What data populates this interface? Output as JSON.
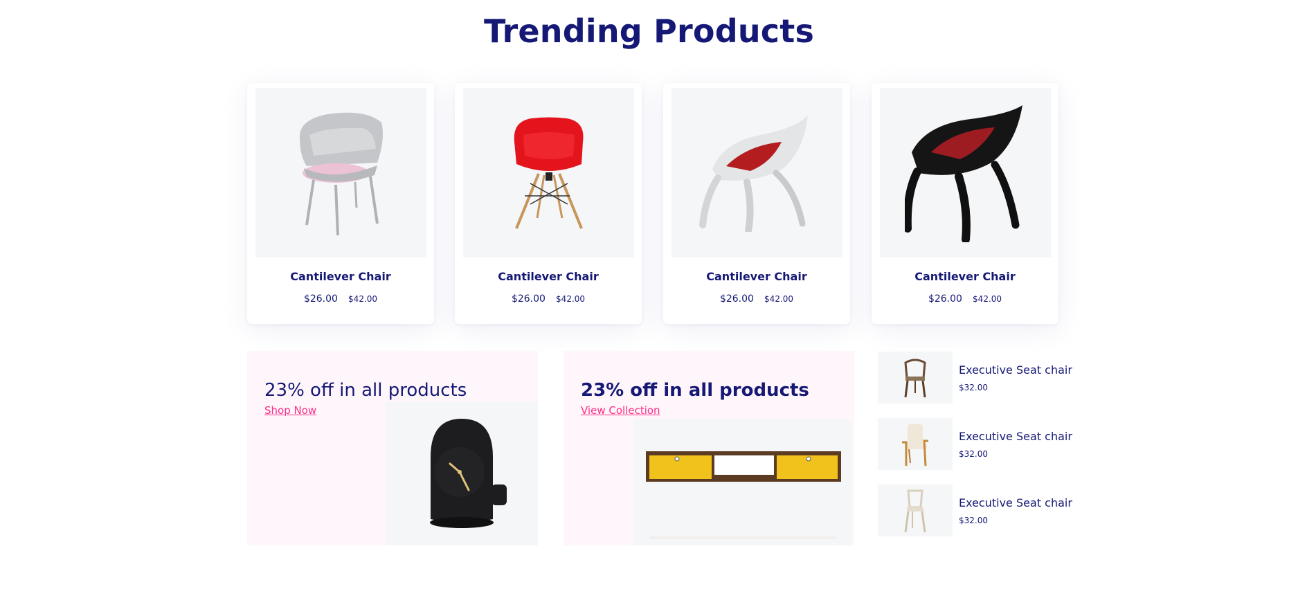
{
  "section": {
    "title": "Trending Products"
  },
  "products": [
    {
      "name": "Cantilever Chair",
      "price": "$26.00",
      "old_price": "$42.00",
      "image": "grey-pink-chair"
    },
    {
      "name": "Cantilever Chair",
      "price": "$26.00",
      "old_price": "$42.00",
      "image": "red-eames-chair"
    },
    {
      "name": "Cantilever Chair",
      "price": "$26.00",
      "old_price": "$42.00",
      "image": "white-red-pod-chair"
    },
    {
      "name": "Cantilever Chair",
      "price": "$26.00",
      "old_price": "$42.00",
      "image": "black-red-pod-chair"
    }
  ],
  "promos": [
    {
      "title": "23% off in all products",
      "link": "Shop Now",
      "image": "black-clock"
    },
    {
      "title": "23% off in all products",
      "link": "View Collection",
      "image": "yellow-media-console"
    }
  ],
  "side_list": [
    {
      "name": "Executive Seat chair",
      "price": "$32.00",
      "image": "wishbone-chair"
    },
    {
      "name": "Executive Seat chair",
      "price": "$32.00",
      "image": "cream-armchair"
    },
    {
      "name": "Executive Seat chair",
      "price": "$32.00",
      "image": "white-bistro-chair"
    }
  ],
  "colors": {
    "navy": "#151875",
    "pink": "#fb2e86",
    "promo_bg": "#fff6fb",
    "image_bg": "#f5f6f8"
  }
}
